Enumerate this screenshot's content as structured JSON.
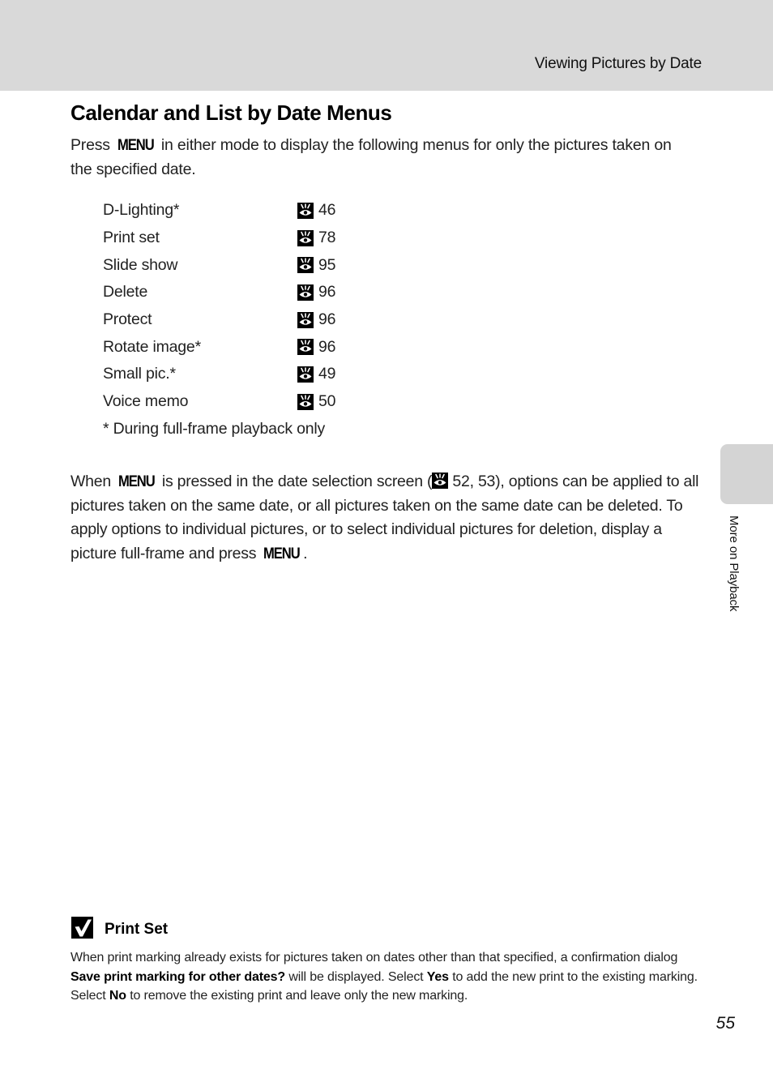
{
  "header": {
    "running_head": "Viewing Pictures by Date"
  },
  "section": {
    "title": "Calendar and List by Date Menus",
    "intro_before": "Press ",
    "menu_key": "MENU",
    "intro_after": " in either mode to display the following menus for only the pictures taken on the specified date."
  },
  "menu_items": [
    {
      "label": "D-Lighting*",
      "icon": "reference-page-icon",
      "page": "46"
    },
    {
      "label": "Print set",
      "icon": "reference-page-icon",
      "page": "78"
    },
    {
      "label": "Slide show",
      "icon": "reference-page-icon",
      "page": "95"
    },
    {
      "label": "Delete",
      "icon": "reference-page-icon",
      "page": "96"
    },
    {
      "label": "Protect",
      "icon": "reference-page-icon",
      "page": "96"
    },
    {
      "label": "Rotate image*",
      "icon": "reference-page-icon",
      "page": "96"
    },
    {
      "label": "Small pic.*",
      "icon": "reference-page-icon",
      "page": "49"
    },
    {
      "label": "Voice memo",
      "icon": "reference-page-icon",
      "page": "50"
    }
  ],
  "footnote": "* During full-frame playback only",
  "body": {
    "part1": "When ",
    "menu_key": "MENU",
    "part2": " is pressed in the date selection screen (",
    "ref_pages": " 52, 53",
    "part3": "), options can be applied to all pictures taken on the same date, or all pictures taken on the same date can be deleted. To apply options to individual pictures, or to select individual pictures for deletion, display a picture full-frame and press ",
    "menu_key_2": "MENU",
    "part4": "."
  },
  "side_tab": {
    "label": "More on Playback"
  },
  "note": {
    "icon": "check-icon",
    "title": "Print Set",
    "text1": "When print marking already exists for pictures taken on dates other than that specified, a confirmation dialog ",
    "bold1": "Save print marking for other dates?",
    "text2": " will be displayed. Select ",
    "bold2": "Yes",
    "text3": " to add the new print to the existing marking. Select ",
    "bold3": "No",
    "text4": " to remove the existing print and leave only the new marking."
  },
  "page_number": "55",
  "colors": {
    "header_band": "#d9d9d9",
    "side_tab": "#d4d4d4",
    "text": "#222222"
  }
}
